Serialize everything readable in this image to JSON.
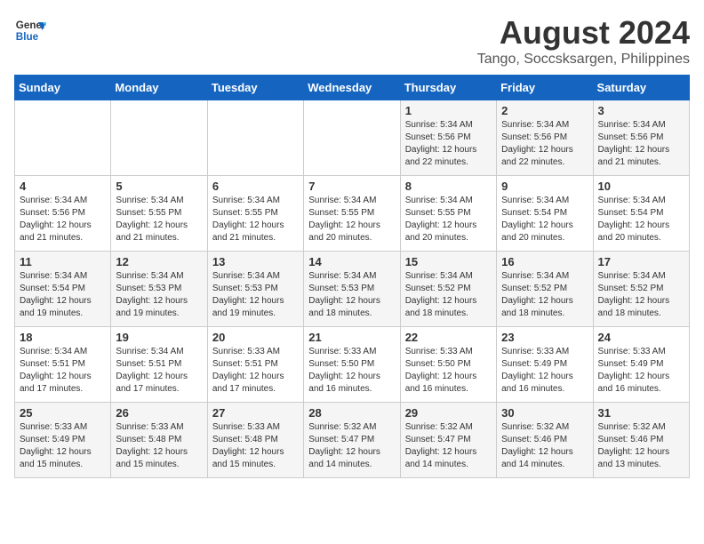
{
  "header": {
    "logo_line1": "General",
    "logo_line2": "Blue",
    "title": "August 2024",
    "subtitle": "Tango, Soccsksargen, Philippines"
  },
  "weekdays": [
    "Sunday",
    "Monday",
    "Tuesday",
    "Wednesday",
    "Thursday",
    "Friday",
    "Saturday"
  ],
  "weeks": [
    [
      {
        "day": "",
        "info": ""
      },
      {
        "day": "",
        "info": ""
      },
      {
        "day": "",
        "info": ""
      },
      {
        "day": "",
        "info": ""
      },
      {
        "day": "1",
        "info": "Sunrise: 5:34 AM\nSunset: 5:56 PM\nDaylight: 12 hours\nand 22 minutes."
      },
      {
        "day": "2",
        "info": "Sunrise: 5:34 AM\nSunset: 5:56 PM\nDaylight: 12 hours\nand 22 minutes."
      },
      {
        "day": "3",
        "info": "Sunrise: 5:34 AM\nSunset: 5:56 PM\nDaylight: 12 hours\nand 21 minutes."
      }
    ],
    [
      {
        "day": "4",
        "info": "Sunrise: 5:34 AM\nSunset: 5:56 PM\nDaylight: 12 hours\nand 21 minutes."
      },
      {
        "day": "5",
        "info": "Sunrise: 5:34 AM\nSunset: 5:55 PM\nDaylight: 12 hours\nand 21 minutes."
      },
      {
        "day": "6",
        "info": "Sunrise: 5:34 AM\nSunset: 5:55 PM\nDaylight: 12 hours\nand 21 minutes."
      },
      {
        "day": "7",
        "info": "Sunrise: 5:34 AM\nSunset: 5:55 PM\nDaylight: 12 hours\nand 20 minutes."
      },
      {
        "day": "8",
        "info": "Sunrise: 5:34 AM\nSunset: 5:55 PM\nDaylight: 12 hours\nand 20 minutes."
      },
      {
        "day": "9",
        "info": "Sunrise: 5:34 AM\nSunset: 5:54 PM\nDaylight: 12 hours\nand 20 minutes."
      },
      {
        "day": "10",
        "info": "Sunrise: 5:34 AM\nSunset: 5:54 PM\nDaylight: 12 hours\nand 20 minutes."
      }
    ],
    [
      {
        "day": "11",
        "info": "Sunrise: 5:34 AM\nSunset: 5:54 PM\nDaylight: 12 hours\nand 19 minutes."
      },
      {
        "day": "12",
        "info": "Sunrise: 5:34 AM\nSunset: 5:53 PM\nDaylight: 12 hours\nand 19 minutes."
      },
      {
        "day": "13",
        "info": "Sunrise: 5:34 AM\nSunset: 5:53 PM\nDaylight: 12 hours\nand 19 minutes."
      },
      {
        "day": "14",
        "info": "Sunrise: 5:34 AM\nSunset: 5:53 PM\nDaylight: 12 hours\nand 18 minutes."
      },
      {
        "day": "15",
        "info": "Sunrise: 5:34 AM\nSunset: 5:52 PM\nDaylight: 12 hours\nand 18 minutes."
      },
      {
        "day": "16",
        "info": "Sunrise: 5:34 AM\nSunset: 5:52 PM\nDaylight: 12 hours\nand 18 minutes."
      },
      {
        "day": "17",
        "info": "Sunrise: 5:34 AM\nSunset: 5:52 PM\nDaylight: 12 hours\nand 18 minutes."
      }
    ],
    [
      {
        "day": "18",
        "info": "Sunrise: 5:34 AM\nSunset: 5:51 PM\nDaylight: 12 hours\nand 17 minutes."
      },
      {
        "day": "19",
        "info": "Sunrise: 5:34 AM\nSunset: 5:51 PM\nDaylight: 12 hours\nand 17 minutes."
      },
      {
        "day": "20",
        "info": "Sunrise: 5:33 AM\nSunset: 5:51 PM\nDaylight: 12 hours\nand 17 minutes."
      },
      {
        "day": "21",
        "info": "Sunrise: 5:33 AM\nSunset: 5:50 PM\nDaylight: 12 hours\nand 16 minutes."
      },
      {
        "day": "22",
        "info": "Sunrise: 5:33 AM\nSunset: 5:50 PM\nDaylight: 12 hours\nand 16 minutes."
      },
      {
        "day": "23",
        "info": "Sunrise: 5:33 AM\nSunset: 5:49 PM\nDaylight: 12 hours\nand 16 minutes."
      },
      {
        "day": "24",
        "info": "Sunrise: 5:33 AM\nSunset: 5:49 PM\nDaylight: 12 hours\nand 16 minutes."
      }
    ],
    [
      {
        "day": "25",
        "info": "Sunrise: 5:33 AM\nSunset: 5:49 PM\nDaylight: 12 hours\nand 15 minutes."
      },
      {
        "day": "26",
        "info": "Sunrise: 5:33 AM\nSunset: 5:48 PM\nDaylight: 12 hours\nand 15 minutes."
      },
      {
        "day": "27",
        "info": "Sunrise: 5:33 AM\nSunset: 5:48 PM\nDaylight: 12 hours\nand 15 minutes."
      },
      {
        "day": "28",
        "info": "Sunrise: 5:32 AM\nSunset: 5:47 PM\nDaylight: 12 hours\nand 14 minutes."
      },
      {
        "day": "29",
        "info": "Sunrise: 5:32 AM\nSunset: 5:47 PM\nDaylight: 12 hours\nand 14 minutes."
      },
      {
        "day": "30",
        "info": "Sunrise: 5:32 AM\nSunset: 5:46 PM\nDaylight: 12 hours\nand 14 minutes."
      },
      {
        "day": "31",
        "info": "Sunrise: 5:32 AM\nSunset: 5:46 PM\nDaylight: 12 hours\nand 13 minutes."
      }
    ]
  ]
}
